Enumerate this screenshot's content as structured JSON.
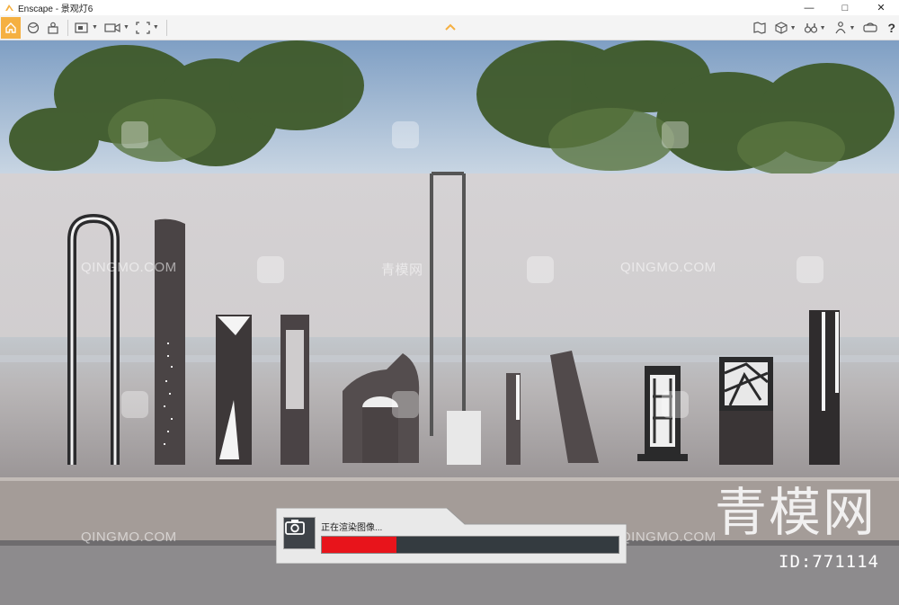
{
  "window": {
    "title": "Enscape - 景观灯6",
    "controls": [
      "minimize",
      "maximize",
      "close"
    ]
  },
  "toolbar": {
    "left_buttons": [
      "home-icon",
      "globe-icon",
      "user-icon",
      "view-capture-icon",
      "video-icon",
      "screenshot-icon"
    ],
    "collapse_icon": "chevron-up-icon",
    "right_buttons": [
      "map-icon",
      "cube-icon",
      "binoculars-icon",
      "person-icon",
      "vr-icon"
    ],
    "help_label": "?",
    "accent_color": "#f5b041"
  },
  "viewport": {
    "watermark_text": "QINGMO.COM",
    "watermark_cn": "青模网",
    "big_watermark": "青模网",
    "id_label": "ID:771114"
  },
  "render_dialog": {
    "label": "正在渲染图像...",
    "progress": 0.25,
    "progress_color": "#e8141b"
  }
}
